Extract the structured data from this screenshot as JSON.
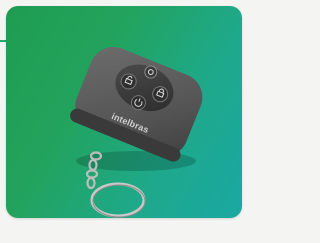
{
  "product": {
    "brand_text": "intelbras",
    "buttons": [
      {
        "name": "top-button",
        "icon": "circle-icon"
      },
      {
        "name": "left-button",
        "icon": "unlock-icon"
      },
      {
        "name": "right-button",
        "icon": "lock-icon"
      },
      {
        "name": "bottom-button",
        "icon": "power-icon"
      }
    ]
  },
  "colors": {
    "background_start": "#1f9c52",
    "background_end": "#1aa8a2",
    "remote_body": "#5e5e5e",
    "keyring": "#bdbdbd"
  }
}
